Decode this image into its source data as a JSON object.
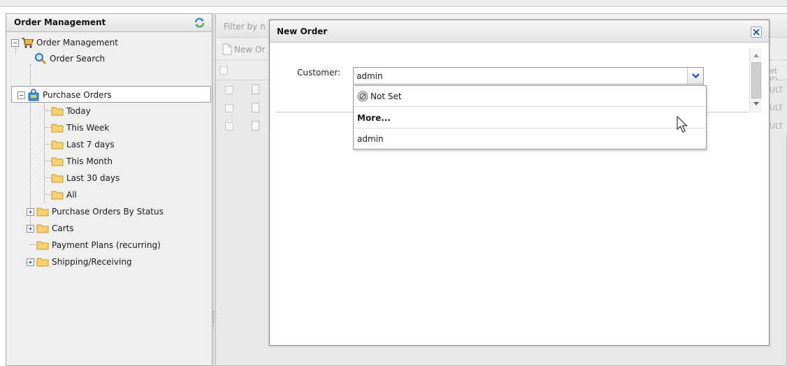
{
  "left_panel": {
    "title": "Order Management",
    "tree": {
      "root": "Order Management",
      "order_search": "Order Search",
      "purchase_orders": "Purchase Orders",
      "today": "Today",
      "this_week": "This Week",
      "last_7_days": "Last 7 days",
      "this_month": "This Month",
      "last_30_days": "Last 30 days",
      "all": "All",
      "by_status": "Purchase Orders By Status",
      "carts": "Carts",
      "payment_plans": "Payment Plans (recurring)",
      "shipping": "Shipping/Receiving"
    }
  },
  "background": {
    "filter_text": "Filter by n",
    "toolbar_new_order": "New Or",
    "col_header_right": "et ID",
    "row_cells": [
      "ULT",
      "ULT",
      "ULT"
    ]
  },
  "dialog": {
    "title": "New Order",
    "customer_label": "Customer:",
    "customer_value": "admin",
    "dropdown_items": [
      "Not Set",
      "More...",
      "admin"
    ]
  },
  "colors": {
    "accent_blue": "#2a5db0",
    "folder_yellow": "#f1c95a"
  }
}
